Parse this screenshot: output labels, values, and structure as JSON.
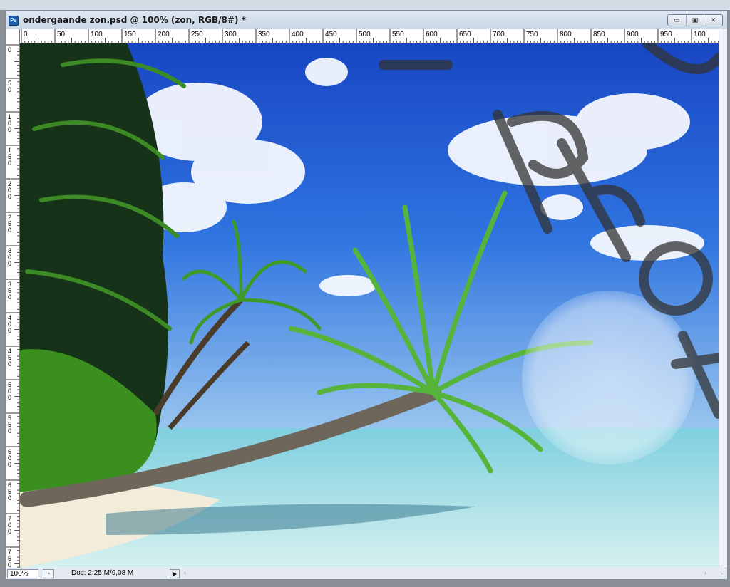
{
  "window": {
    "title": "ondergaande zon.psd @ 100% (zon, RGB/8#) *",
    "app_icon_text": "Ps",
    "buttons": [
      "minimize-icon",
      "restore-icon",
      "close-icon"
    ]
  },
  "rulers": {
    "horizontal_labels": [
      "0",
      "50",
      "100",
      "150",
      "200",
      "250",
      "300",
      "350",
      "400",
      "450",
      "500",
      "550",
      "600",
      "650",
      "700",
      "750",
      "800",
      "850",
      "900",
      "950",
      "100"
    ],
    "vertical_labels": [
      "0",
      "50",
      "100",
      "150",
      "200",
      "250",
      "300",
      "350",
      "400",
      "450",
      "500",
      "550",
      "600",
      "650",
      "700",
      "750"
    ]
  },
  "statusbar": {
    "zoom": "100%",
    "doc_info": "Doc: 2,25 M/9,08 M",
    "menu_arrow": "▶"
  },
  "canvas": {
    "description_icon": "photo-canvas",
    "colors": {
      "sky": "#1f5fd6",
      "sea": "#8fd6e0",
      "sand": "#f2ead8"
    }
  }
}
